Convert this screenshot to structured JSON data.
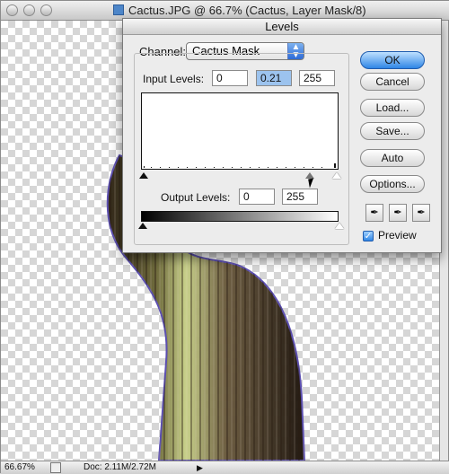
{
  "window": {
    "title": "Cactus.JPG @ 66.7% (Cactus, Layer Mask/8)"
  },
  "dialog": {
    "title": "Levels",
    "channel_label": "Channel:",
    "channel_value": "Cactus Mask",
    "input_levels_label": "Input Levels:",
    "input_levels": {
      "black": "0",
      "gamma": "0.21",
      "white": "255"
    },
    "output_levels_label": "Output Levels:",
    "output_levels": {
      "black": "0",
      "white": "255"
    },
    "buttons": {
      "ok": "OK",
      "cancel": "Cancel",
      "load": "Load...",
      "save": "Save...",
      "auto": "Auto",
      "options": "Options..."
    },
    "preview_label": "Preview",
    "preview_checked": true
  },
  "status_bar": {
    "zoom": "66.67%",
    "doc_size": "Doc: 2.11M/2.72M"
  },
  "icons": {
    "dropper_black": "eyedropper-black-icon",
    "dropper_gray": "eyedropper-gray-icon",
    "dropper_white": "eyedropper-white-icon"
  },
  "colors": {
    "ok_button": "#2f86e6",
    "gamma_field": "#9cc3ee"
  }
}
